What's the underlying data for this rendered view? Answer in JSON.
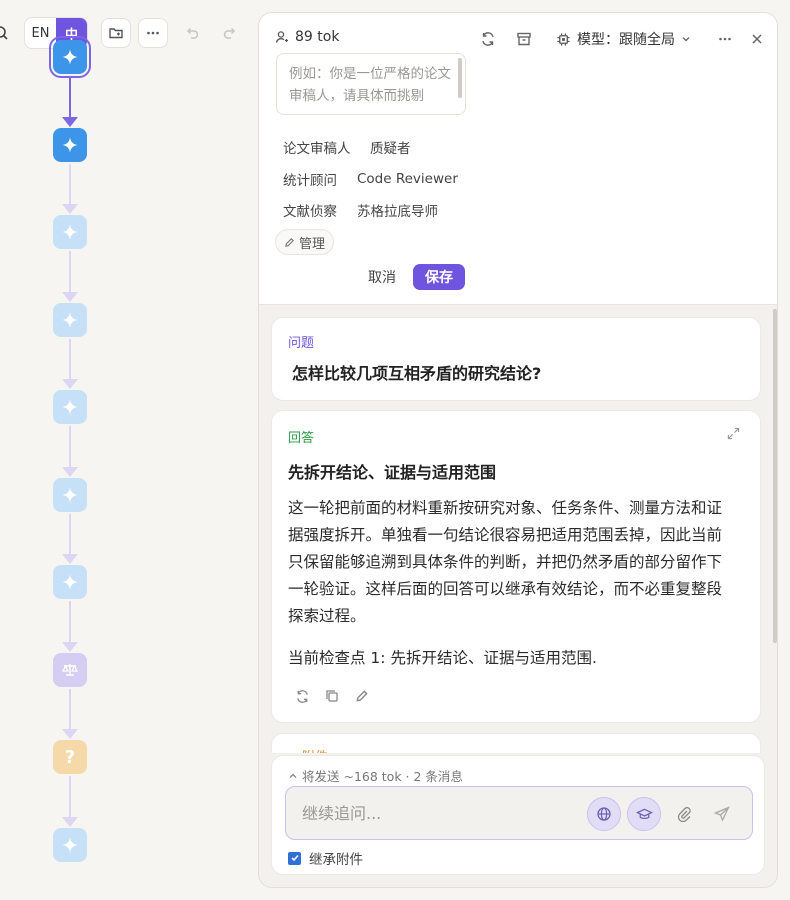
{
  "toolbar": {
    "lang_en": "EN",
    "lang_zh": "中",
    "active_lang": "zh"
  },
  "flow": {
    "nodes": [
      {
        "kind": "spark",
        "state": "active"
      },
      {
        "kind": "spark",
        "state": "active"
      },
      {
        "kind": "spark",
        "state": "pending"
      },
      {
        "kind": "spark",
        "state": "pending"
      },
      {
        "kind": "spark",
        "state": "pending"
      },
      {
        "kind": "spark",
        "state": "pending"
      },
      {
        "kind": "spark",
        "state": "pending"
      },
      {
        "kind": "judge",
        "state": "pending"
      },
      {
        "kind": "question",
        "state": "pending",
        "glyph": "?"
      },
      {
        "kind": "spark",
        "state": "pending"
      }
    ],
    "accent": "#6f54e0",
    "active_color": "#3d95ea",
    "pending_color": "#c6e1f7"
  },
  "panel": {
    "tokens": "89 tok",
    "model_label": "模型：跟随全局",
    "prompt_placeholder": "例如：你是一位严格的论文审稿人，请具体而挑剔",
    "personas": [
      "论文审稿人",
      "质疑者",
      "统计顾问",
      "Code Reviewer",
      "文献侦察",
      "苏格拉底导师"
    ],
    "manage_label": "管理",
    "cancel_label": "取消",
    "save_label": "保存"
  },
  "question": {
    "label": "问题",
    "text": "怎样比较几项互相矛盾的研究结论?"
  },
  "answer": {
    "label": "回答",
    "title": "先拆开结论、证据与适用范围",
    "body_lines": [
      "这一轮把前面的材料重新按研究对象、任务条件、测量方法和证",
      "据强度拆开。单独看一句结论很容易把适用范围丢掉，因此当前",
      "只保留能够追溯到具体条件的判断，并把仍然矛盾的部分留作下",
      "一轮验证。这样后面的回答可以继承有效结论，而不必重复整段",
      "探索过程。"
    ],
    "checkpoint": "当前检查点 1: 先拆开结论、证据与适用范围."
  },
  "attachment": {
    "label": "附件"
  },
  "composer": {
    "send_info": "将发送 ~168 tok · 2 条消息",
    "input_placeholder": "继续追问...",
    "inherit_label": "继承附件",
    "inherit_checked": true
  }
}
